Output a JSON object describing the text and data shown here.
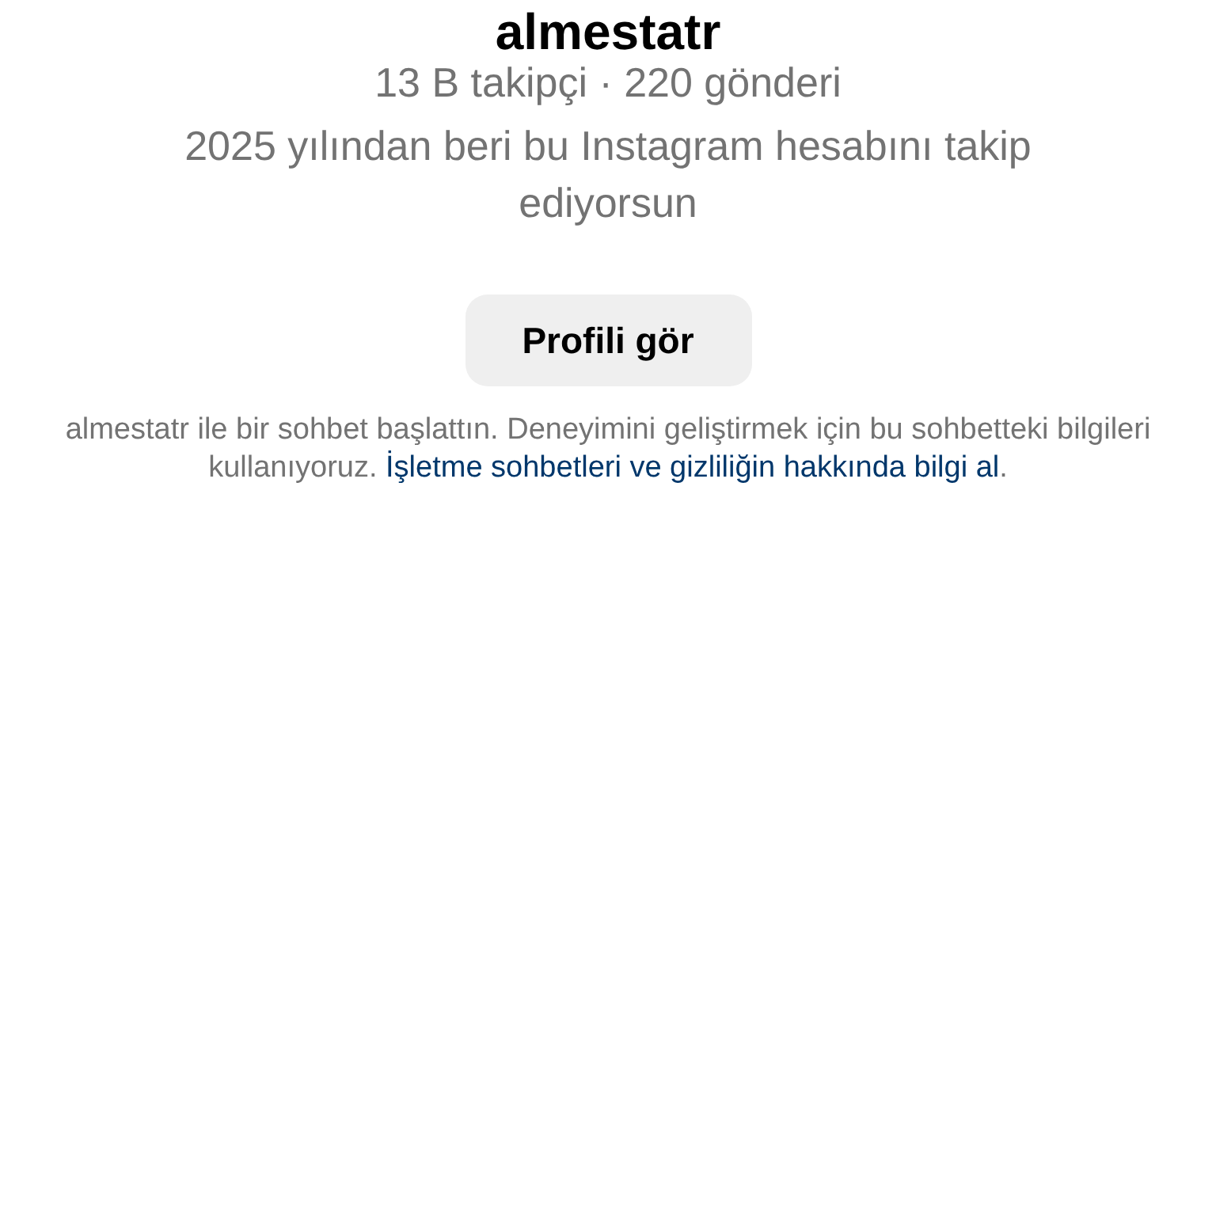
{
  "profile": {
    "name": "almestatr",
    "stats": "13 B takipçi · 220 gönderi",
    "follow_note": "2025 yılından beri bu Instagram hesabını takip ediyorsun",
    "button": "Profili gör"
  },
  "notice": {
    "text": "almestatr ile bir sohbet başlattın. Deneyimini geliştirmek için bu sohbetteki bilgileri kullanıyoruz.",
    "link": "İşletme sohbetleri ve gizliliğin hakkında bilgi al",
    "end": "."
  }
}
